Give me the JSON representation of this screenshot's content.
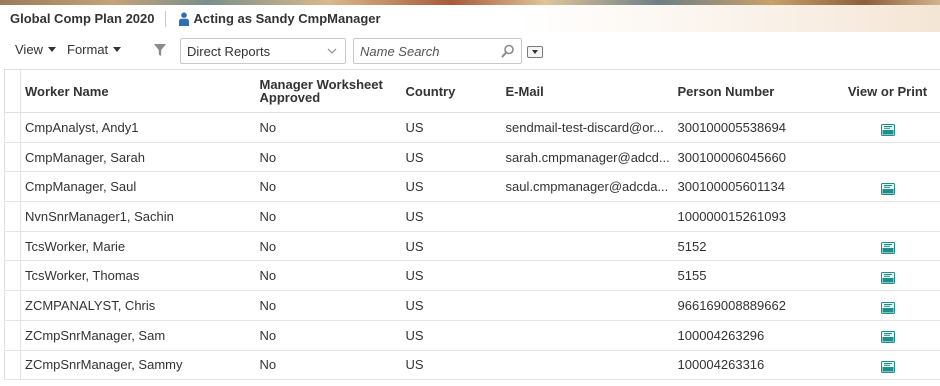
{
  "header": {
    "app_title": "Global Comp Plan 2020",
    "acting_as": "Acting as Sandy CmpManager"
  },
  "toolbar": {
    "view_label": "View",
    "format_label": "Format",
    "filter_select_value": "Direct Reports",
    "search_placeholder": "Name Search"
  },
  "table": {
    "columns": [
      "Worker Name",
      "Manager Worksheet Approved",
      "Country",
      "E-Mail",
      "Person Number",
      "View or Print"
    ],
    "rows": [
      {
        "name": "CmpAnalyst, Andy1",
        "approved": "No",
        "country": "US",
        "email": "sendmail-test-discard@or...",
        "person_number": "300100005538694",
        "pdf": true
      },
      {
        "name": "CmpManager, Sarah",
        "approved": "No",
        "country": "US",
        "email": "sarah.cmpmanager@adcd...",
        "person_number": "300100006045660",
        "pdf": false
      },
      {
        "name": "CmpManager, Saul",
        "approved": "No",
        "country": "US",
        "email": "saul.cmpmanager@adcda...",
        "person_number": "300100005601134",
        "pdf": true
      },
      {
        "name": "NvnSnrManager1, Sachin",
        "approved": "No",
        "country": "US",
        "email": "",
        "person_number": "100000015261093",
        "pdf": false
      },
      {
        "name": "TcsWorker, Marie",
        "approved": "No",
        "country": "US",
        "email": "",
        "person_number": "5152",
        "pdf": true
      },
      {
        "name": "TcsWorker, Thomas",
        "approved": "No",
        "country": "US",
        "email": "",
        "person_number": "5155",
        "pdf": true
      },
      {
        "name": "ZCMPANALYST, Chris",
        "approved": "No",
        "country": "US",
        "email": "",
        "person_number": "966169008889662",
        "pdf": true
      },
      {
        "name": "ZCmpSnrManager, Sam",
        "approved": "No",
        "country": "US",
        "email": "",
        "person_number": "100004263296",
        "pdf": true
      },
      {
        "name": "ZCmpSnrManager, Sammy",
        "approved": "No",
        "country": "US",
        "email": "",
        "person_number": "100004263316",
        "pdf": true
      }
    ]
  },
  "icons": {
    "person": "person-icon",
    "filter": "funnel-icon",
    "search": "magnifier-icon",
    "pdf": "pdf-file-icon"
  },
  "colors": {
    "accent_blue": "#2f6fb5",
    "pdf_teal": "#1f8f8c",
    "text": "#333333",
    "border": "#e0e0e0"
  }
}
